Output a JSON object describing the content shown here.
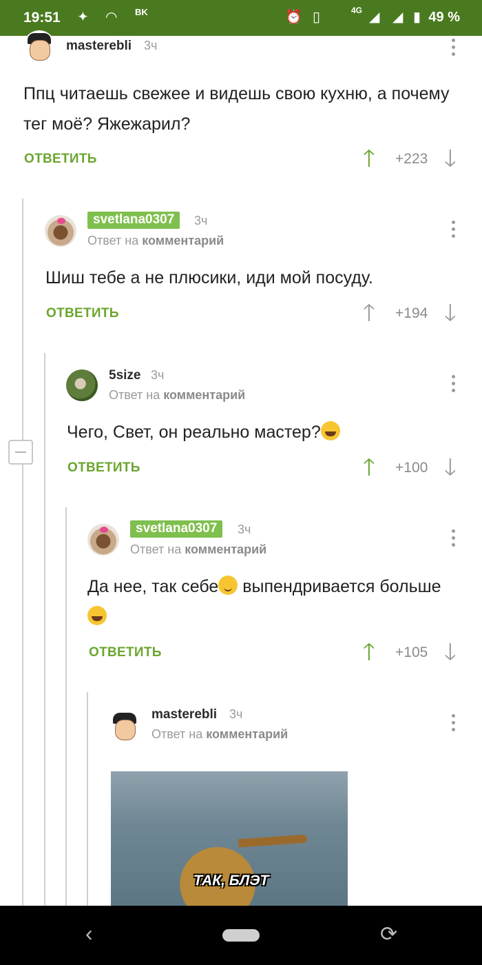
{
  "status_bar": {
    "time": "19:51",
    "battery": "49 %",
    "network": "4G"
  },
  "comments": [
    {
      "username": "masterebli",
      "time": "3ч",
      "reply_to": "",
      "text": "Ппц читаешь свежее и видешь свою кухню, а почему тег моё? Яжежарил?",
      "reply_label": "ОТВЕТИТЬ",
      "score": "+223",
      "upvoted": true
    },
    {
      "username": "svetlana0307",
      "time": "3ч",
      "reply_prefix": "Ответ на",
      "reply_to": "комментарий",
      "text": "Шиш тебе а не плюсики, иди мой посуду.",
      "reply_label": "ОТВЕТИТЬ",
      "score": "+194",
      "upvoted": false
    },
    {
      "username": "5size",
      "time": "3ч",
      "reply_prefix": "Ответ на",
      "reply_to": "комментарий",
      "text": "Чего, Свет, он реально мастер?",
      "reply_label": "ОТВЕТИТЬ",
      "score": "+100",
      "upvoted": true
    },
    {
      "username": "svetlana0307",
      "time": "3ч",
      "reply_prefix": "Ответ на",
      "reply_to": "комментарий",
      "text_part1": "Да нее, так себе",
      "text_part2": " выпендривается больше ",
      "reply_label": "ОТВЕТИТЬ",
      "score": "+105",
      "upvoted": true
    },
    {
      "username": "masterebli",
      "time": "3ч",
      "reply_prefix": "Ответ на",
      "reply_to": "комментарий",
      "image_caption": "ТАК, БЛЭТ"
    }
  ],
  "colors": {
    "status_bar": "#4a7a1f",
    "accent_green": "#6aa62e",
    "badge_green": "#7fbf4d"
  },
  "icons": {
    "upvote": "arrow-up-icon",
    "downvote": "arrow-down-icon",
    "menu": "more-vertical-icon"
  }
}
